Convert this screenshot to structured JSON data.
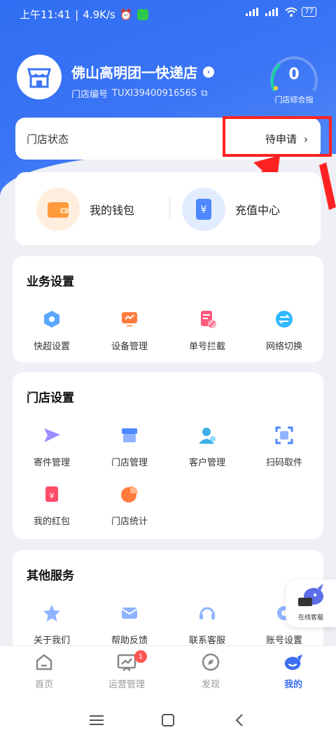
{
  "status_bar": {
    "time": "上午11:41",
    "speed": "4.9K/s",
    "battery": "77"
  },
  "store": {
    "name": "佛山高明团一快递店",
    "id_label": "门店编号",
    "id_value": "TUXI3940091656S"
  },
  "gauge": {
    "value": "0",
    "label": "门店综合指"
  },
  "store_status": {
    "label": "门店状态",
    "value": "待申请"
  },
  "wallet": [
    {
      "label": "我的钱包",
      "icon": "wallet-icon"
    },
    {
      "label": "充值中心",
      "icon": "recharge-icon"
    }
  ],
  "business": {
    "title": "业务设置",
    "items": [
      {
        "label": "快超设置",
        "icon": "hexagon-icon"
      },
      {
        "label": "设备管理",
        "icon": "monitor-icon"
      },
      {
        "label": "单号拦截",
        "icon": "block-order-icon"
      },
      {
        "label": "网络切换",
        "icon": "switch-icon"
      }
    ]
  },
  "store_settings": {
    "title": "门店设置",
    "items": [
      {
        "label": "寄件管理",
        "icon": "send-icon"
      },
      {
        "label": "门店管理",
        "icon": "shop-icon"
      },
      {
        "label": "客户管理",
        "icon": "customer-icon"
      },
      {
        "label": "扫码取件",
        "icon": "scan-icon"
      },
      {
        "label": "我的红包",
        "icon": "red-envelope-icon"
      },
      {
        "label": "门店统计",
        "icon": "pie-chart-icon"
      }
    ]
  },
  "other": {
    "title": "其他服务",
    "items": [
      {
        "label": "关于我们",
        "icon": "star-icon"
      },
      {
        "label": "帮助反馈",
        "icon": "feedback-icon"
      },
      {
        "label": "联系客服",
        "icon": "headset-icon"
      },
      {
        "label": "账号设置",
        "icon": "settings-icon"
      }
    ]
  },
  "online_cs": {
    "label": "在线客服"
  },
  "tabbar": [
    {
      "label": "首页",
      "icon": "home-icon"
    },
    {
      "label": "运营管理",
      "icon": "operations-icon",
      "badge": "1"
    },
    {
      "label": "发现",
      "icon": "compass-icon"
    },
    {
      "label": "我的",
      "icon": "mine-icon"
    }
  ],
  "colors": {
    "primary": "#3b75f5",
    "highlight": "#ff2222",
    "active_tab": "#3b6ff0"
  }
}
